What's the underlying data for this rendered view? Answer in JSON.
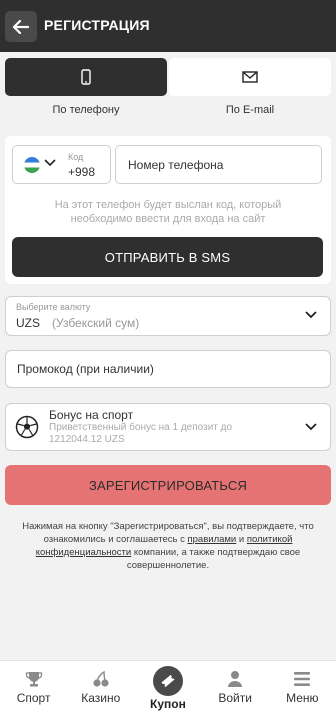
{
  "header": {
    "title": "РЕГИСТРАЦИЯ"
  },
  "tabs": [
    {
      "label": "По телефону",
      "icon": "phone-icon",
      "active": true
    },
    {
      "label": "По E-mail",
      "icon": "envelope-icon",
      "active": false
    }
  ],
  "phone_form": {
    "country_flag": "uzbekistan-flag",
    "code_label": "Код",
    "code_value": "+998",
    "phone_placeholder": "Номер телефона",
    "hint": "На этот телефон будет выслан код, который необходимо ввести для входа на сайт",
    "sms_button": "ОТПРАВИТЬ В SMS"
  },
  "currency": {
    "label": "Выберите валюту",
    "code": "UZS",
    "name": "(Узбекский сум)"
  },
  "promo": {
    "placeholder": "Промокод (при наличии)"
  },
  "bonus": {
    "title": "Бонус на спорт",
    "subtitle": "Приветственный бонус на 1 депозит до 1212044.12 UZS"
  },
  "register_button": "ЗАРЕГИСТРИРОВАТЬСЯ",
  "legal": {
    "part1": "Нажимая на кнопку \"Зарегистрироваться\", вы подтверждаете, что ознакомились и соглашаетесь с ",
    "rules_link": "правилами",
    "part2": " и ",
    "privacy_link": "политикой конфиденциальности",
    "part3": " компании, а также подтверждаю свое совершеннолетие."
  },
  "bottom_nav": [
    {
      "label": "Спорт",
      "icon": "trophy-icon"
    },
    {
      "label": "Казино",
      "icon": "cherries-icon"
    },
    {
      "label": "Купон",
      "icon": "ticket-icon"
    },
    {
      "label": "Войти",
      "icon": "user-icon"
    },
    {
      "label": "Меню",
      "icon": "menu-icon"
    }
  ],
  "colors": {
    "header_bg": "#2f2f2f",
    "register_button_bg": "#e57373",
    "page_bg": "#f2f2f2"
  }
}
